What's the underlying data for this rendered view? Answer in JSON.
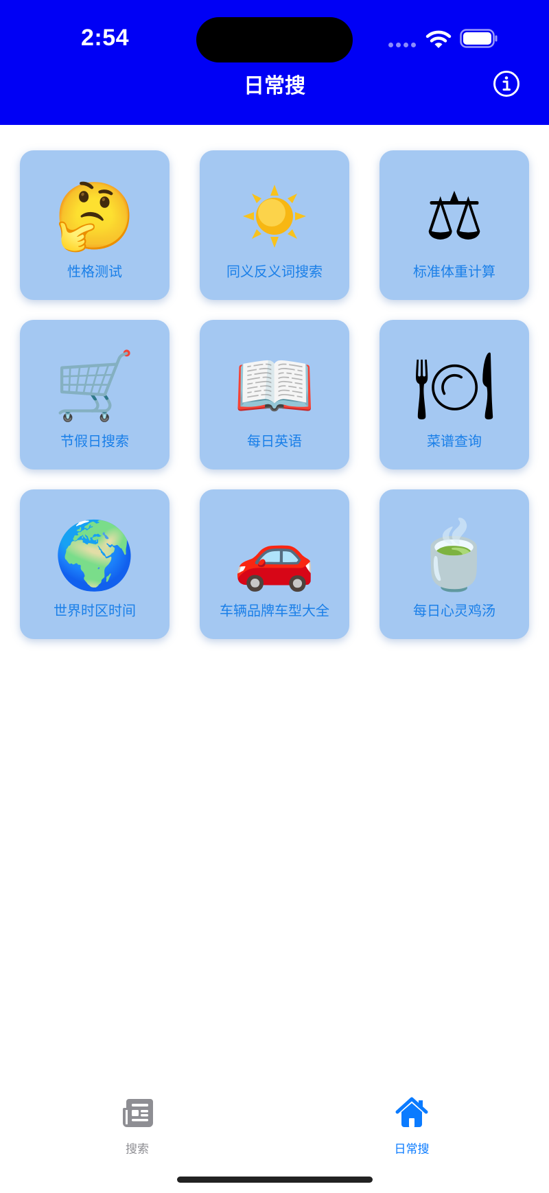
{
  "status_bar": {
    "time": "2:54"
  },
  "header": {
    "title": "日常搜",
    "background_color": "#0000f5",
    "info_icon": "info-circle-icon"
  },
  "grid": {
    "items": [
      {
        "label": "性格测试",
        "icon": "thinking-face-icon",
        "glyph": "🤔"
      },
      {
        "label": "同义反义词搜索",
        "icon": "sun-icon",
        "glyph": "☀"
      },
      {
        "label": "标准体重计算",
        "icon": "balance-scale-icon",
        "glyph": "⚖"
      },
      {
        "label": "节假日搜索",
        "icon": "shopping-cart-icon",
        "glyph": "🛒"
      },
      {
        "label": "每日英语",
        "icon": "open-book-icon",
        "glyph": "📖"
      },
      {
        "label": "菜谱查询",
        "icon": "fork-knife-plate-icon",
        "glyph": "🍽"
      },
      {
        "label": "世界时区时间",
        "icon": "globe-europe-africa-icon",
        "glyph": "🌍"
      },
      {
        "label": "车辆品牌车型大全",
        "icon": "red-car-icon",
        "glyph": "🚗"
      },
      {
        "label": "每日心灵鸡汤",
        "icon": "teacup-icon",
        "glyph": "🍵"
      }
    ],
    "card_color": "#a4c8f2",
    "label_color": "#1a7fe8"
  },
  "tab_bar": {
    "tabs": [
      {
        "label": "搜索",
        "icon": "newspaper-icon",
        "selected": false
      },
      {
        "label": "日常搜",
        "icon": "house-icon",
        "selected": true
      }
    ],
    "active_color": "#0a7bff",
    "inactive_color": "#8e8e93"
  }
}
